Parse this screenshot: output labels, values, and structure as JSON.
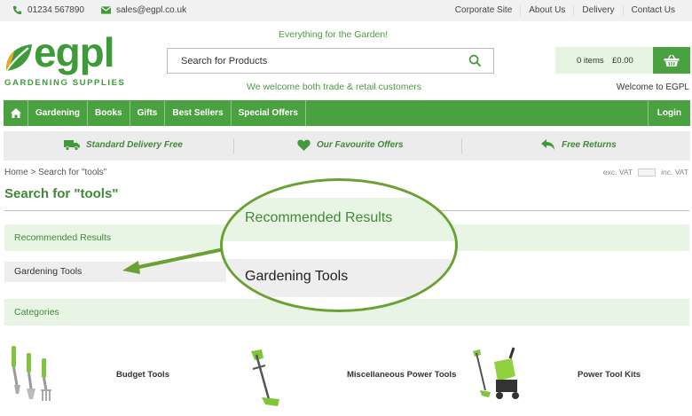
{
  "topbar": {
    "phone": "01234 567890",
    "email": "sales@egpl.co.uk",
    "links": [
      "Corporate Site",
      "About Us",
      "Delivery",
      "Contact Us"
    ]
  },
  "header": {
    "logo_word": "egpl",
    "logo_tag": "GARDENING SUPPLIES",
    "tagline_top": "Everything for the Garden!",
    "tagline_bottom": "We welcome both trade & retail customers",
    "search_placeholder": "Search for Products",
    "cart_items": "0 items",
    "cart_total": "£0.00",
    "welcome": "Welcome to EGPL"
  },
  "nav": {
    "items": [
      "Gardening",
      "Books",
      "Gifts",
      "Best Sellers",
      "Special Offers"
    ],
    "login": "Login"
  },
  "usp": {
    "delivery": "Standard Delivery Free",
    "offers": "Our Favourite Offers",
    "returns": "Free Returns"
  },
  "breadcrumb": "Home > Search for \"tools\"",
  "vat": {
    "exc": "exc. VAT",
    "inc": "inc. VAT"
  },
  "page_title": "Search for \"tools\"",
  "recommended": {
    "heading": "Recommended Results",
    "items": [
      "Gardening Tools"
    ]
  },
  "callout": {
    "heading": "Recommended Results",
    "item": "Gardening Tools"
  },
  "categories": {
    "heading": "Categories",
    "items": [
      "Budget Tools",
      "Miscellaneous Power Tools",
      "Power Tool Kits"
    ]
  },
  "colors": {
    "brand_green": "#4aa13f",
    "light_green": "#e8f5e4",
    "callout_border": "#6aa133"
  }
}
